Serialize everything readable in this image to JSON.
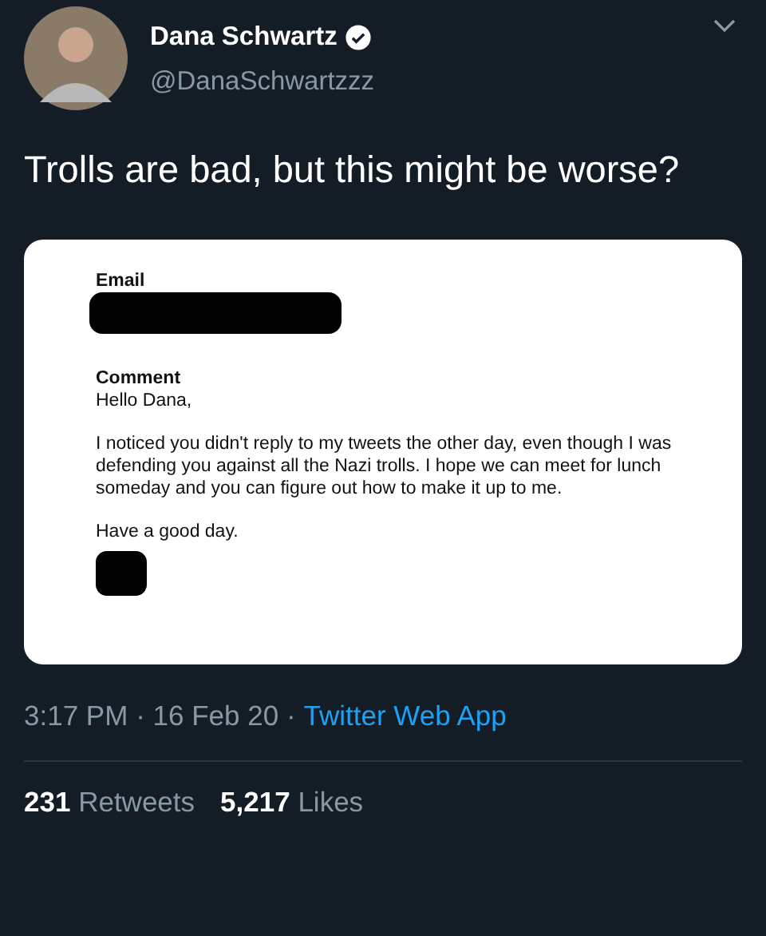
{
  "tweet": {
    "author": {
      "name": "Dana Schwartz",
      "handle": "@DanaSchwartzzz",
      "verified": true
    },
    "text": "Trolls are bad, but this might be worse?",
    "attachment": {
      "email_label": "Email",
      "comment_label": "Comment",
      "greeting": "Hello Dana,",
      "body": "I noticed you didn't reply to my tweets the other day, even though I was defending you against all the Nazi trolls. I hope we can meet for lunch someday and you can figure out how to make it up to me.",
      "closing": "Have a good day."
    },
    "meta": {
      "time": "3:17 PM",
      "separator": "·",
      "date": "16 Feb 20",
      "source": "Twitter Web App"
    },
    "stats": [
      {
        "count": "231",
        "label": "Retweets"
      },
      {
        "count": "5,217",
        "label": "Likes"
      }
    ]
  }
}
